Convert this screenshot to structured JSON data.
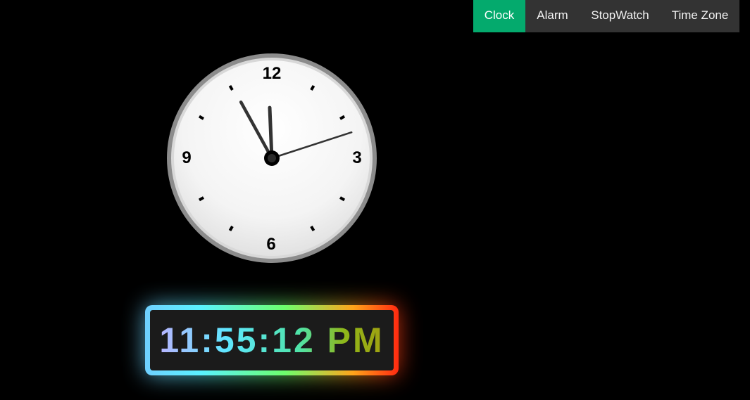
{
  "nav": {
    "tabs": [
      {
        "label": "Clock",
        "active": true
      },
      {
        "label": "Alarm",
        "active": false
      },
      {
        "label": "StopWatch",
        "active": false
      },
      {
        "label": "Time Zone",
        "active": false
      }
    ]
  },
  "analog_clock": {
    "numerals": {
      "n12": "12",
      "n3": "3",
      "n6": "6",
      "n9": "9"
    },
    "time": {
      "hours": 11,
      "minutes": 55,
      "seconds": 12
    }
  },
  "digital_clock": {
    "time_text": "11:55:12 PM"
  },
  "colors": {
    "nav_background": "#333333",
    "active_tab": "#04aa6d",
    "page_background": "#000000"
  }
}
